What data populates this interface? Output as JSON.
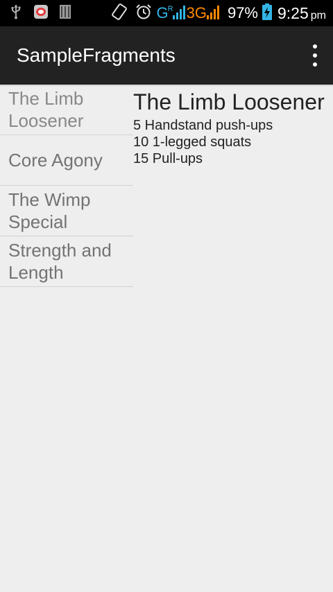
{
  "status_bar": {
    "network_type": "G",
    "roaming_indicator": "R",
    "network_type_2": "3G",
    "battery_percent": "97%",
    "time": "9:25",
    "ampm": "pm",
    "icons": [
      "usb-icon",
      "message-icon",
      "sd-card-icon",
      "screen-rotation-icon",
      "alarm-icon",
      "signal-icon",
      "battery-charging-icon"
    ],
    "colors": {
      "g_network": "#33b5e5",
      "network_3g": "#ff8800",
      "battery": "#33b5e5"
    }
  },
  "action_bar": {
    "title": "SampleFragments",
    "overflow_icon": "more-vertical-icon"
  },
  "workouts": [
    {
      "label": "The Limb Loosener",
      "selected": true
    },
    {
      "label": "Core Agony",
      "selected": false
    },
    {
      "label": "The Wimp Special",
      "selected": false
    },
    {
      "label": "Strength and Length",
      "selected": false
    }
  ],
  "detail": {
    "title": "The Limb Loosener",
    "exercises": [
      "5 Handstand push-ups",
      "10 1-legged squats",
      "15 Pull-ups"
    ]
  },
  "colors": {
    "status_bar_bg": "#000000",
    "action_bar_bg": "#222222",
    "content_bg": "#eeeeee"
  }
}
